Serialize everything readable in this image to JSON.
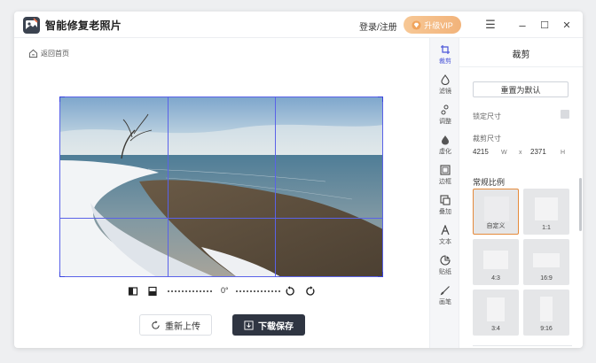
{
  "app": {
    "title": "智能修复老照片"
  },
  "header": {
    "login_label": "登录/注册",
    "vip_label": "升级VIP",
    "menu_glyph": "☰",
    "minimize_glyph": "–",
    "maximize_glyph": "☐",
    "close_glyph": "✕"
  },
  "nav": {
    "back_label": "返回首页"
  },
  "editor": {
    "rotation_label": "0°",
    "reupload_label": "重新上传",
    "save_label": "下载保存"
  },
  "tools": [
    {
      "label": "裁剪",
      "icon": "crop-icon"
    },
    {
      "label": "滤镜",
      "icon": "filter-icon"
    },
    {
      "label": "调整",
      "icon": "adjust-icon"
    },
    {
      "label": "虚化",
      "icon": "blur-icon"
    },
    {
      "label": "边框",
      "icon": "border-icon"
    },
    {
      "label": "叠加",
      "icon": "overlay-icon"
    },
    {
      "label": "文本",
      "icon": "text-icon"
    },
    {
      "label": "贴纸",
      "icon": "sticker-icon"
    },
    {
      "label": "画笔",
      "icon": "brush-icon"
    }
  ],
  "panel": {
    "title": "裁剪",
    "reset_label": "重置为默认",
    "lock_label": "锁定尺寸",
    "size_label": "裁剪尺寸",
    "width_value": "4215",
    "width_unit": "W",
    "separator": "x",
    "height_value": "2371",
    "height_unit": "H",
    "ratio_title": "常规比例",
    "ratios": [
      {
        "label": "自定义"
      },
      {
        "label": "1:1"
      },
      {
        "label": "4:3"
      },
      {
        "label": "16:9"
      },
      {
        "label": "3:4"
      },
      {
        "label": "9:16"
      }
    ]
  },
  "colors": {
    "accent": "#4a55d8",
    "vip_gradient_start": "#f7c896",
    "vip_gradient_end": "#f2b37a",
    "primary_button": "#2f3542",
    "selected_ratio_border": "#e48a3b"
  }
}
